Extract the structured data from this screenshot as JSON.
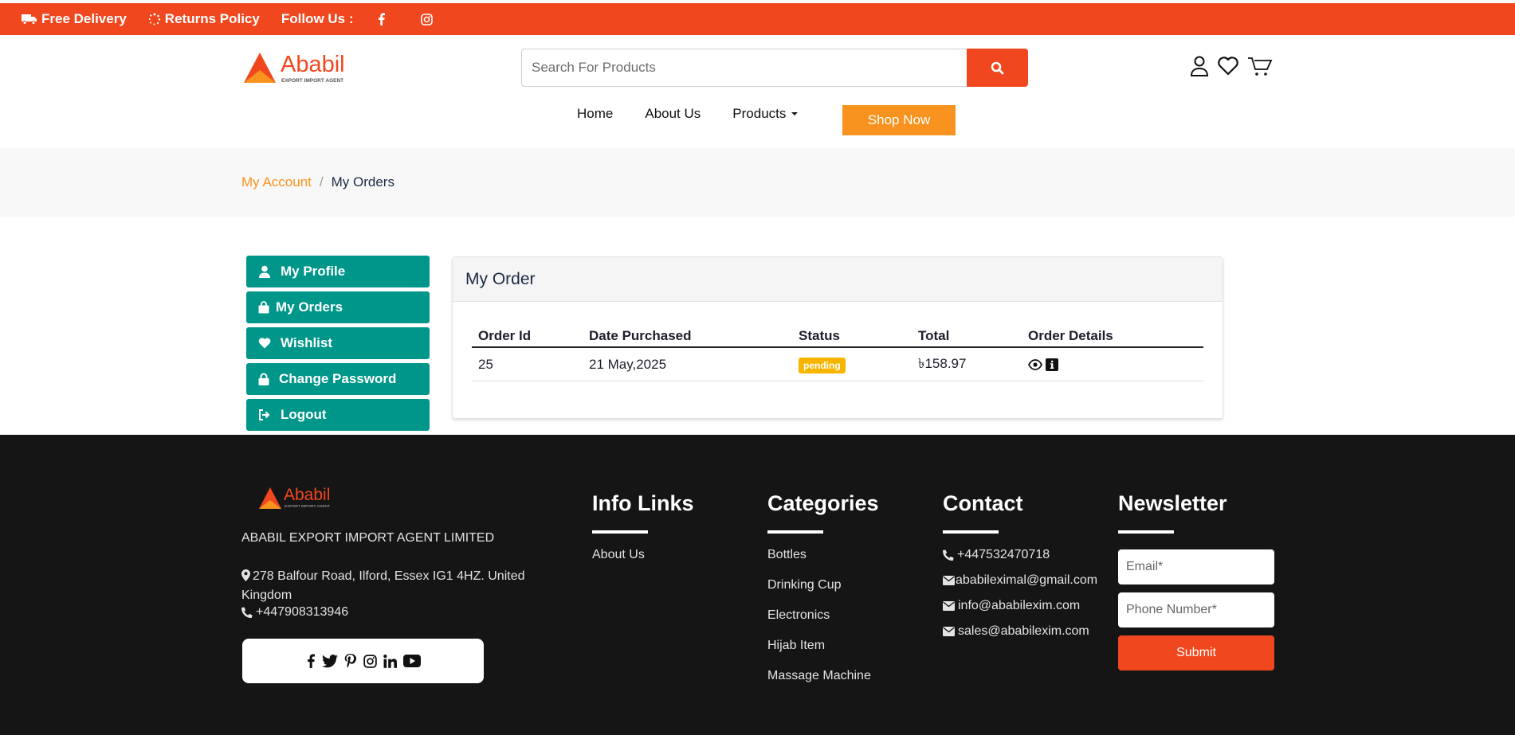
{
  "colors": {
    "brand": "#f1471f",
    "accent": "#f7931e",
    "sidebar": "#00968a",
    "footer": "#151515",
    "badge": "#f7b500"
  },
  "topbar": {
    "free_delivery": "Free Delivery",
    "returns_policy": "Returns Policy",
    "follow_us": "Follow Us :",
    "social_icons": [
      "facebook-icon",
      "instagram-icon"
    ]
  },
  "logo": {
    "name": "Ababil",
    "tagline": "EXPORT IMPORT AGENT"
  },
  "search": {
    "placeholder": "Search For Products"
  },
  "header_icons": [
    "user-icon",
    "heart-icon",
    "cart-icon"
  ],
  "nav": {
    "home": "Home",
    "about": "About Us",
    "products": "Products",
    "shop_now": "Shop Now"
  },
  "breadcrumb": {
    "parent": "My Account",
    "separator": "/",
    "current": "My Orders"
  },
  "sidebar": {
    "items": [
      {
        "label": "My Profile",
        "icon": "user-icon"
      },
      {
        "label": "My Orders",
        "icon": "bag-icon"
      },
      {
        "label": "Wishlist",
        "icon": "heart-icon"
      },
      {
        "label": "Change Password",
        "icon": "lock-icon"
      },
      {
        "label": "Logout",
        "icon": "logout-icon"
      }
    ]
  },
  "orders": {
    "title": "My Order",
    "columns": [
      "Order Id",
      "Date Purchased",
      "Status",
      "Total",
      "Order Details"
    ],
    "rows": [
      {
        "id": "25",
        "date": "21 May,2025",
        "status": "pending",
        "total": "৳158.97",
        "details_icons": [
          "eye-icon",
          "info-icon"
        ]
      }
    ]
  },
  "footer": {
    "logo_name": "Ababil",
    "logo_tagline": "EXPORT IMPORT AGENT",
    "company": "ABABIL EXPORT IMPORT AGENT LIMITED",
    "address": "278 Balfour Road, Ilford, Essex IG1 4HZ. United Kingdom",
    "phone": "+447908313946",
    "social_icons": [
      "facebook-icon",
      "twitter-icon",
      "pinterest-icon",
      "instagram-icon",
      "linkedin-icon",
      "youtube-icon"
    ],
    "info_links": {
      "title": "Info Links",
      "items": [
        "About Us"
      ]
    },
    "categories": {
      "title": "Categories",
      "items": [
        "Bottles",
        "Drinking Cup",
        "Electronics",
        "Hijab Item",
        "Massage Machine"
      ]
    },
    "contact": {
      "title": "Contact",
      "phone": "+447532470718",
      "email1": "ababileximal@gmail.com",
      "email2": "info@ababilexim.com",
      "email3": "sales@ababilexim.com"
    },
    "newsletter": {
      "title": "Newsletter",
      "email_placeholder": "Email*",
      "phone_placeholder": "Phone Number*",
      "submit": "Submit"
    }
  }
}
